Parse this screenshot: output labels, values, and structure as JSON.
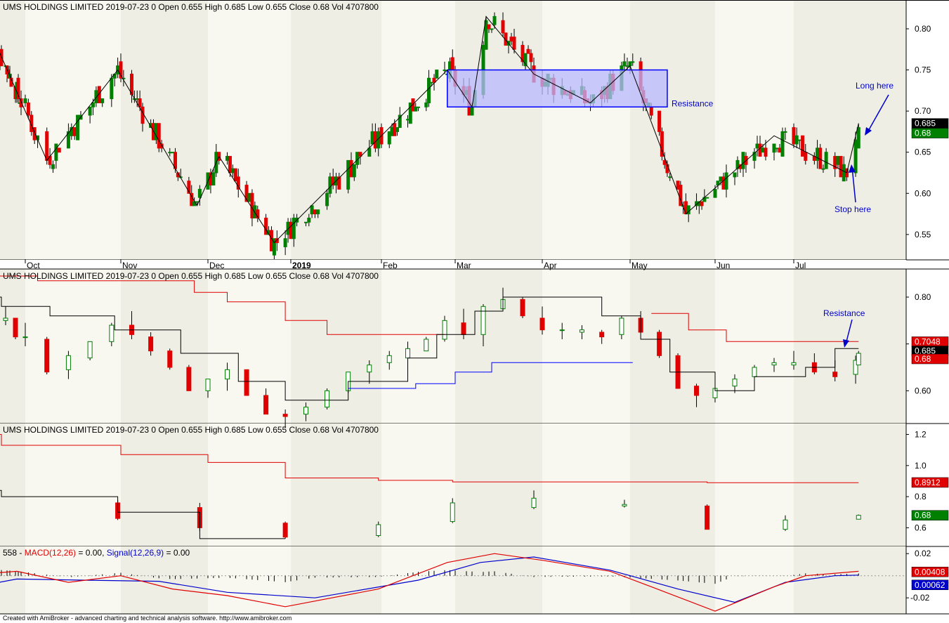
{
  "header": {
    "title": "UMS HOLDINGS LIMITED",
    "date": "2019-07-23",
    "flag": "0",
    "open": "Open 0.655",
    "high": "High 0.685",
    "low": "Low 0.655",
    "close": "Close 0.68",
    "vol": "Vol 4707800"
  },
  "macd_header": {
    "id": "558",
    "macd": "MACD(12,26)",
    "macd_val": " = 0.00, ",
    "signal": "Signal(12,26,9)",
    "signal_val": " = 0.00"
  },
  "footer": "Created with AmiBroker - advanced charting and technical analysis software. http://www.amibroker.com",
  "colors": {
    "up": "#008000",
    "down": "#e00000",
    "resistance_fill": "#b8b8ff",
    "resistance_border": "#0000ff",
    "annotation": "#0000cc",
    "band_dark": "#eeeee4",
    "band_light": "#f8f8f0"
  },
  "chart_data": [
    {
      "type": "candlestick",
      "panel": "price",
      "x_axis": {
        "type": "date",
        "labels": [
          "Oct",
          "Nov",
          "Dec",
          "2019",
          "Feb",
          "Mar",
          "Apr",
          "May",
          "Jun",
          "Jul"
        ],
        "label_dates": [
          "2018-10-01",
          "2018-11-01",
          "2018-12-03",
          "2019-01-02",
          "2019-02-01",
          "2019-03-01",
          "2019-04-01",
          "2019-05-02",
          "2019-06-03",
          "2019-07-01"
        ]
      },
      "y_ticks": [
        0.55,
        0.6,
        0.65,
        0.7,
        0.75,
        0.8
      ],
      "ylim": [
        0.52,
        0.835
      ],
      "last_labels": [
        "0.685",
        "0.68"
      ],
      "zigzag": [
        {
          "date": "2018-09-04",
          "price": 0.715
        },
        {
          "date": "2018-09-13",
          "price": 0.77
        },
        {
          "date": "2018-10-08",
          "price": 0.64
        },
        {
          "date": "2018-10-31",
          "price": 0.75
        },
        {
          "date": "2018-11-29",
          "price": 0.585
        },
        {
          "date": "2018-12-07",
          "price": 0.645
        },
        {
          "date": "2018-12-27",
          "price": 0.54
        },
        {
          "date": "2019-02-26",
          "price": 0.75
        },
        {
          "date": "2019-03-07",
          "price": 0.705
        },
        {
          "date": "2019-03-12",
          "price": 0.815
        },
        {
          "date": "2019-03-29",
          "price": 0.745
        },
        {
          "date": "2019-04-18",
          "price": 0.71
        },
        {
          "date": "2019-05-02",
          "price": 0.755
        },
        {
          "date": "2019-05-23",
          "price": 0.575
        },
        {
          "date": "2019-06-24",
          "price": 0.67
        },
        {
          "date": "2019-07-19",
          "price": 0.625
        },
        {
          "date": "2019-07-23",
          "price": 0.685
        }
      ],
      "resistance_zone": {
        "start": "2019-02-26",
        "end": "2019-05-16",
        "low": 0.705,
        "high": 0.75,
        "label": "Resistance"
      },
      "annotations": [
        {
          "text": "Long here",
          "date": "2019-07-23",
          "price": 0.685
        },
        {
          "text": "Stop here",
          "date": "2019-07-19",
          "price": 0.645
        }
      ]
    },
    {
      "type": "candlestick",
      "panel": "higher-timeframe",
      "y_ticks": [
        0.6,
        0.7,
        0.8
      ],
      "ylim": [
        0.53,
        0.86
      ],
      "last_labels": [
        "0.7048",
        "0.685",
        "0.68"
      ],
      "annotations": [
        {
          "text": "Resistance",
          "price": 0.7
        }
      ]
    },
    {
      "type": "candlestick",
      "panel": "monthly",
      "y_ticks": [
        0.6,
        0.8,
        1.0,
        1.2
      ],
      "ylim": [
        0.48,
        1.27
      ],
      "last_labels": [
        "0.8912",
        "0.68"
      ]
    },
    {
      "type": "line",
      "panel": "macd",
      "y_ticks": [
        0.02,
        -0.02
      ],
      "ylim": [
        -0.0345,
        0.0265
      ],
      "series": [
        {
          "name": "MACD(12,26)",
          "color": "#e00000"
        },
        {
          "name": "Signal(12,26,9)",
          "color": "#0000cc"
        }
      ],
      "last_labels": [
        "0.00408",
        "0.00062"
      ]
    }
  ]
}
